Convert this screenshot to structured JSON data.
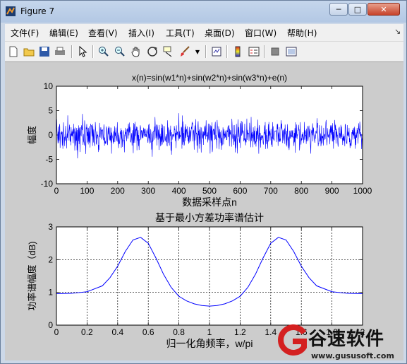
{
  "window": {
    "title": "Figure 7"
  },
  "menu": {
    "items": [
      "文件(F)",
      "编辑(E)",
      "查看(V)",
      "插入(I)",
      "工具(T)",
      "桌面(D)",
      "窗口(W)",
      "帮助(H)"
    ]
  },
  "toolbar": {
    "icons": [
      "new-figure-icon",
      "open-file-icon",
      "save-icon",
      "print-icon",
      "pointer-icon",
      "zoom-in-icon",
      "zoom-out-icon",
      "pan-hand-icon",
      "rotate-3d-icon",
      "data-cursor-icon",
      "brush-icon",
      "link-plot-icon",
      "colorbar-icon",
      "legend-icon",
      "hide-plot-tools-icon",
      "show-plot-tools-icon"
    ]
  },
  "chart_data": [
    {
      "type": "line",
      "title": "x(n)=sin(w1*n)+sin(w2*n)+sin(w3*n)+e(n)",
      "xlabel": "数据采样点n",
      "ylabel": "幅度",
      "xlim": [
        0,
        1000
      ],
      "ylim": [
        -10,
        10
      ],
      "xticks": [
        "0",
        "100",
        "200",
        "300",
        "400",
        "500",
        "600",
        "700",
        "800",
        "900",
        "1000"
      ],
      "yticks": [
        "-10",
        "-5",
        "0",
        "5",
        "10"
      ],
      "grid": false,
      "color": "#0000ff",
      "series": [
        {
          "description": "noisy signal, approximately 1000 samples oscillating roughly between -5.5 and 6.5"
        }
      ]
    },
    {
      "type": "line",
      "title": "基于最小方差功率谱估计",
      "xlabel": "归一化角频率，w/pi",
      "ylabel": "功率谱幅度（dB)",
      "xlim": [
        0,
        2
      ],
      "ylim": [
        0,
        3
      ],
      "xticks": [
        "0",
        "0.2",
        "0.4",
        "0.6",
        "0.8",
        "1",
        "1.2",
        "1.4",
        "1.6",
        "1.8",
        "2"
      ],
      "yticks": [
        "0",
        "1",
        "2",
        "3"
      ],
      "grid": true,
      "color": "#0000ff",
      "series": [
        {
          "x": [
            0,
            0.1,
            0.2,
            0.3,
            0.35,
            0.4,
            0.45,
            0.5,
            0.55,
            0.6,
            0.65,
            0.7,
            0.75,
            0.8,
            0.85,
            0.9,
            0.95,
            1.0,
            1.05,
            1.1,
            1.15,
            1.2,
            1.25,
            1.3,
            1.35,
            1.4,
            1.45,
            1.5,
            1.55,
            1.6,
            1.65,
            1.7,
            1.8,
            1.9,
            2.0
          ],
          "y": [
            0.96,
            0.97,
            1.02,
            1.2,
            1.45,
            1.8,
            2.25,
            2.6,
            2.68,
            2.5,
            2.05,
            1.55,
            1.15,
            0.88,
            0.74,
            0.65,
            0.6,
            0.58,
            0.6,
            0.65,
            0.74,
            0.88,
            1.15,
            1.55,
            2.05,
            2.5,
            2.68,
            2.6,
            2.25,
            1.8,
            1.45,
            1.2,
            1.02,
            0.97,
            0.96
          ]
        }
      ]
    }
  ],
  "watermark": {
    "text": "谷速软件",
    "url": "www.gususoft.com"
  }
}
